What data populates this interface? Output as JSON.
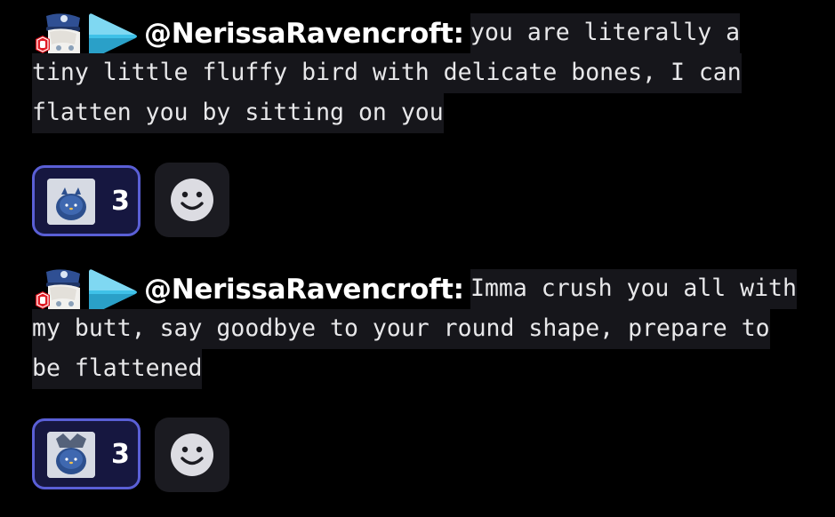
{
  "messages": [
    {
      "username": "@NerissaRavencroft:",
      "text": "you are literally a tiny little fluffy bird with delicate bones, I can flatten you by sitting on you",
      "reaction": {
        "emoji": "fluffy-blue-bird-emoji",
        "count": "3"
      },
      "add_reaction_icon": "smiley-face-icon"
    },
    {
      "username": "@NerissaRavencroft:",
      "text": "Imma crush you all with my butt, say goodbye to your round shape, prepare to be flattened",
      "reaction": {
        "emoji": "fluffy-blue-bird-emoji",
        "count": "3"
      },
      "add_reaction_icon": "smiley-face-icon"
    }
  ],
  "colors": {
    "background": "#000000",
    "message_highlight": "#16161b",
    "reaction_border": "#5a5fd6",
    "reaction_fill": "#161740",
    "add_reaction_fill": "#1b1b21",
    "smiley": "#dcdce2",
    "play_badge": "#3fc1e8"
  }
}
